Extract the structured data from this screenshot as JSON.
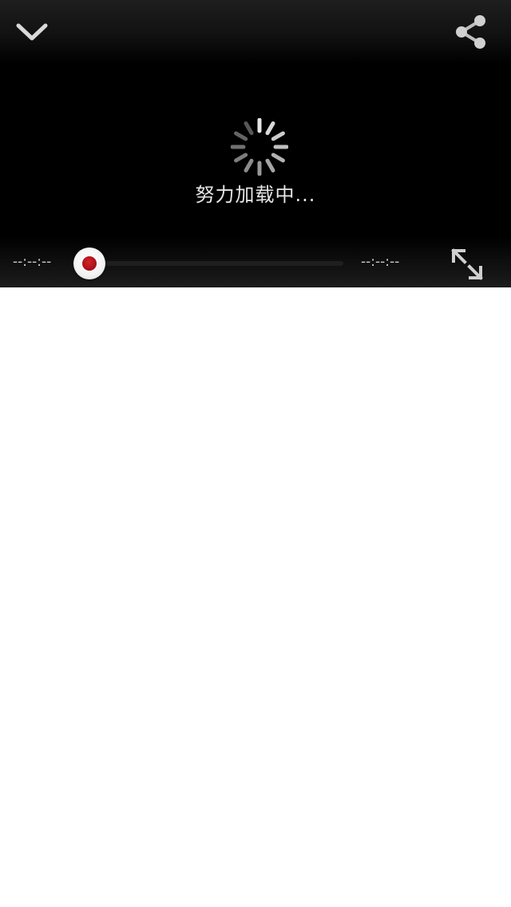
{
  "player": {
    "loading_text": "努力加载中...",
    "current_time": "--:--:--",
    "total_time": "--:--:--",
    "progress": 0,
    "icons": {
      "collapse": "chevron-down-icon",
      "share": "share-icon",
      "fullscreen": "fullscreen-expand-icon",
      "spinner": "loading-spinner-icon"
    },
    "colors": {
      "background": "#000000",
      "icon": "#d9d9d9",
      "time_text": "#cfcfcf",
      "thumb_accent": "#b3101a"
    }
  }
}
